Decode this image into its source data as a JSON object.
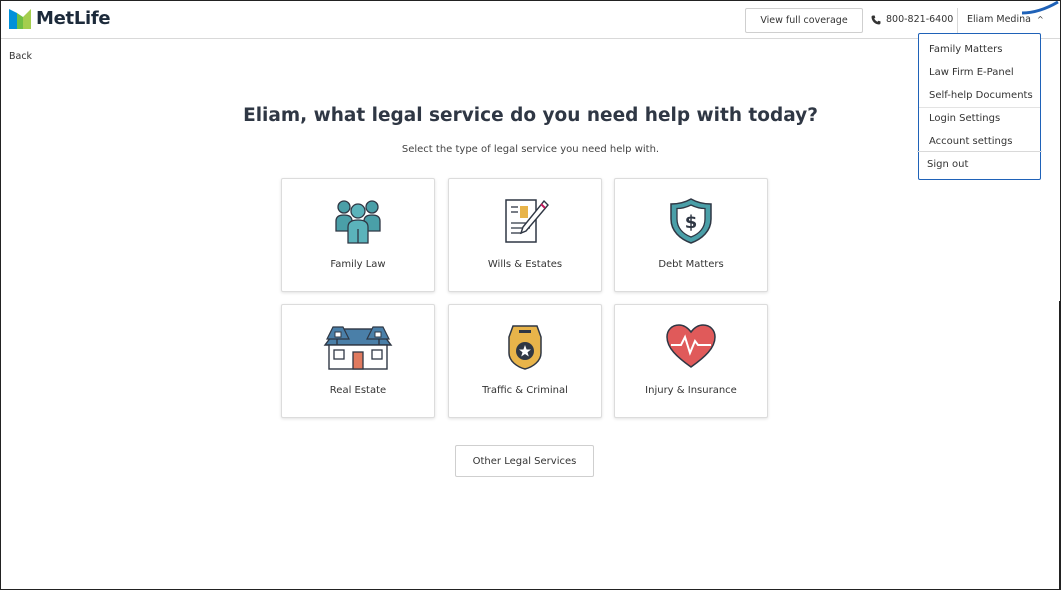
{
  "header": {
    "brand": "MetLife",
    "coverage_button": "View full coverage",
    "phone": "800-821-6400",
    "user_name": "Eliam Medina",
    "chevron": "^"
  },
  "nav": {
    "back": "Back"
  },
  "dropdown": {
    "items": [
      "Family Matters",
      "Law Firm E-Panel",
      "Self-help Documents",
      "Login Settings",
      "Account settings"
    ],
    "signout": "Sign out"
  },
  "main": {
    "title": "Eliam, what legal service do you need help with today?",
    "subtitle": "Select the type of legal service you need help with.",
    "cards": [
      {
        "label": "Family Law",
        "icon": "family-icon"
      },
      {
        "label": "Wills & Estates",
        "icon": "document-pen-icon"
      },
      {
        "label": "Debt Matters",
        "icon": "dollar-shield-icon"
      },
      {
        "label": "Real Estate",
        "icon": "house-icon"
      },
      {
        "label": "Traffic & Criminal",
        "icon": "police-badge-icon"
      },
      {
        "label": "Injury & Insurance",
        "icon": "heart-pulse-icon"
      }
    ],
    "other_button": "Other Legal Services"
  },
  "colors": {
    "brand_blue": "#0090da",
    "brand_green": "#a4ce4e",
    "teal": "#4a9fa8",
    "dropdown_border": "#1f62b8",
    "heart_red": "#e05a5a",
    "badge_gold": "#e8b44a"
  }
}
